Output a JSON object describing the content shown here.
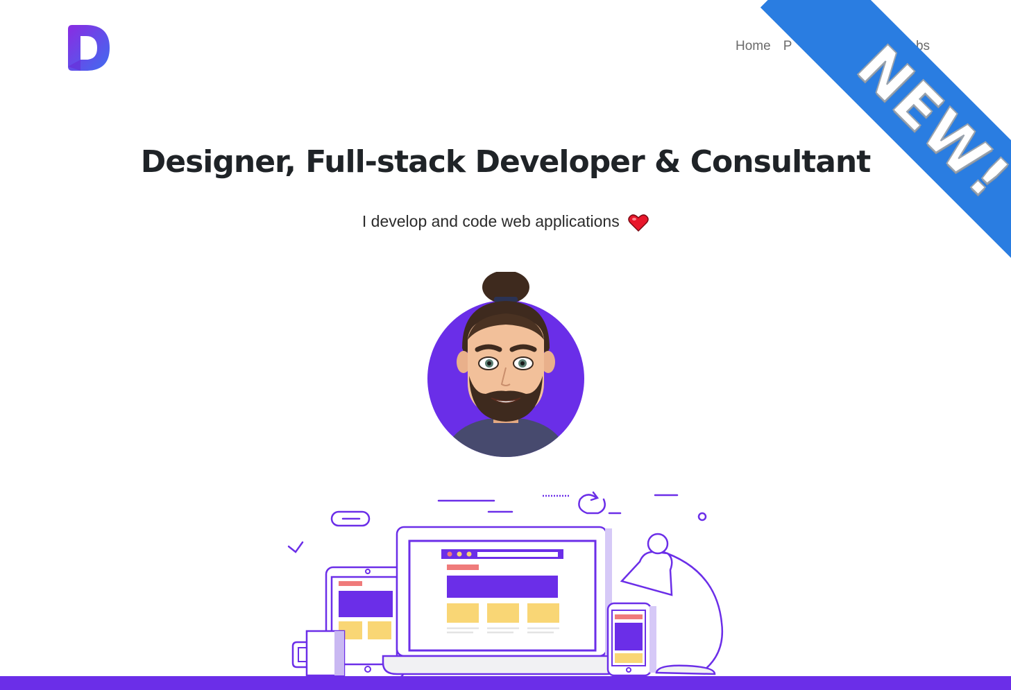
{
  "brand": {
    "logo_letter": "D",
    "colors": {
      "logo_start": "#8a2be2",
      "logo_end": "#3f6df0"
    }
  },
  "nav": {
    "items": [
      {
        "label": "Home"
      },
      {
        "label": "P"
      },
      {
        "label": "abs"
      }
    ]
  },
  "ribbon": {
    "label": "NEW!",
    "color": "#2a7de1"
  },
  "hero": {
    "headline": "Designer, Full-stack Developer & Consultant",
    "subline": "I develop and code web applications",
    "heart_icon": "heart-icon"
  },
  "theme": {
    "accent": "#6b2ee8",
    "yellow": "#f9d675",
    "pink": "#ef7b7b"
  }
}
